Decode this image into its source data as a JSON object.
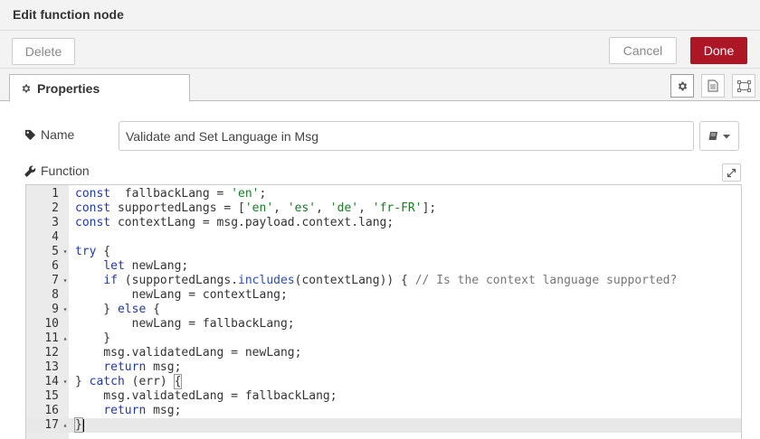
{
  "window": {
    "title": "Edit function node"
  },
  "toolbar": {
    "delete_label": "Delete",
    "cancel_label": "Cancel",
    "done_label": "Done"
  },
  "tabs": [
    {
      "label": "Properties",
      "icon": "gear-icon",
      "active": true
    }
  ],
  "side_icons": [
    "gear-icon",
    "document-icon",
    "appearance-icon"
  ],
  "form": {
    "name_label": "Name",
    "name_value": "Validate and Set Language in Msg",
    "function_label": "Function"
  },
  "colors": {
    "done": "#ad1625",
    "keyword": "#1f3aa8",
    "string": "#1a7a2a",
    "comment": "#777777"
  },
  "editor": {
    "current_line": 17,
    "lines": [
      {
        "n": "1",
        "fold": "",
        "tokens": [
          [
            "kw",
            "const"
          ],
          [
            "",
            "  fallbackLang = "
          ],
          [
            "str",
            "'en'"
          ],
          [
            "",
            ";"
          ]
        ]
      },
      {
        "n": "2",
        "fold": "",
        "tokens": [
          [
            "kw",
            "const"
          ],
          [
            "",
            " supportedLangs = ["
          ],
          [
            "str",
            "'en'"
          ],
          [
            "",
            ", "
          ],
          [
            "str",
            "'es'"
          ],
          [
            "",
            ", "
          ],
          [
            "str",
            "'de'"
          ],
          [
            "",
            ", "
          ],
          [
            "str",
            "'fr-FR'"
          ],
          [
            "",
            "];"
          ]
        ]
      },
      {
        "n": "3",
        "fold": "",
        "tokens": [
          [
            "kw",
            "const"
          ],
          [
            "",
            " contextLang = msg.payload.context.lang;"
          ]
        ]
      },
      {
        "n": "4",
        "fold": "",
        "tokens": []
      },
      {
        "n": "5",
        "fold": "▾",
        "tokens": [
          [
            "kw",
            "try"
          ],
          [
            "",
            " {"
          ]
        ]
      },
      {
        "n": "6",
        "fold": "",
        "tokens": [
          [
            "",
            "    "
          ],
          [
            "kw",
            "let"
          ],
          [
            "",
            " newLang;"
          ]
        ]
      },
      {
        "n": "7",
        "fold": "▾",
        "tokens": [
          [
            "",
            "    "
          ],
          [
            "kw",
            "if"
          ],
          [
            "",
            " (supportedLangs."
          ],
          [
            "fn",
            "includes"
          ],
          [
            "",
            "(contextLang)) { "
          ],
          [
            "cm",
            "// Is the context language supported?"
          ]
        ]
      },
      {
        "n": "8",
        "fold": "",
        "tokens": [
          [
            "",
            "        newLang = contextLang;"
          ]
        ]
      },
      {
        "n": "9",
        "fold": "▾",
        "tokens": [
          [
            "",
            "    } "
          ],
          [
            "kw",
            "else"
          ],
          [
            "",
            " {"
          ]
        ]
      },
      {
        "n": "10",
        "fold": "",
        "tokens": [
          [
            "",
            "        newLang = fallbackLang;"
          ]
        ]
      },
      {
        "n": "11",
        "fold": "▴",
        "tokens": [
          [
            "",
            "    }"
          ]
        ]
      },
      {
        "n": "12",
        "fold": "",
        "tokens": [
          [
            "",
            "    msg.validatedLang = newLang;"
          ]
        ]
      },
      {
        "n": "13",
        "fold": "",
        "tokens": [
          [
            "",
            "    "
          ],
          [
            "kw",
            "return"
          ],
          [
            "",
            " msg;"
          ]
        ]
      },
      {
        "n": "14",
        "fold": "▾",
        "tokens": [
          [
            "",
            "} "
          ],
          [
            "kw",
            "catch"
          ],
          [
            "",
            " (err) "
          ],
          [
            "bracket",
            "{"
          ]
        ]
      },
      {
        "n": "15",
        "fold": "",
        "tokens": [
          [
            "",
            "    msg.validatedLang = fallbackLang;"
          ]
        ]
      },
      {
        "n": "16",
        "fold": "",
        "tokens": [
          [
            "",
            "    "
          ],
          [
            "kw",
            "return"
          ],
          [
            "",
            " msg;"
          ]
        ]
      },
      {
        "n": "17",
        "fold": "▴",
        "tokens": [
          [
            "bracket",
            "}"
          ],
          [
            "cursor",
            ""
          ]
        ]
      }
    ]
  }
}
